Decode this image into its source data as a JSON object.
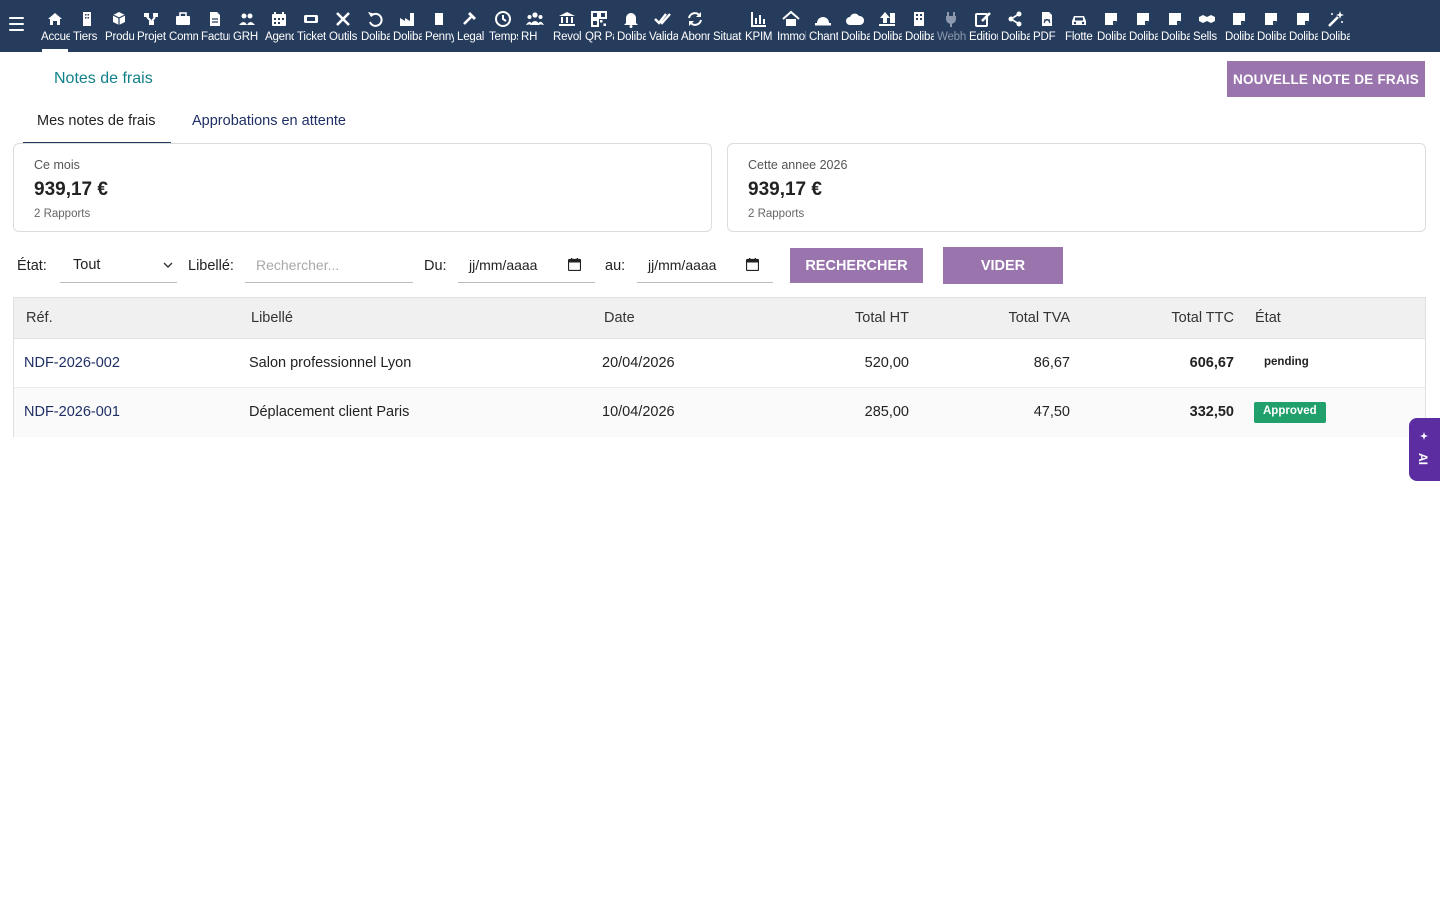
{
  "app": {
    "menu_label": "Menu",
    "nav_items": [
      {
        "label": "Accueil",
        "icon": "home-icon",
        "active": true
      },
      {
        "label": "Tiers",
        "icon": "building-icon"
      },
      {
        "label": "Produits",
        "icon": "cube-icon"
      },
      {
        "label": "Projets",
        "icon": "project-icon"
      },
      {
        "label": "Commercial",
        "icon": "briefcase-icon"
      },
      {
        "label": "Factures",
        "icon": "invoice-icon"
      },
      {
        "label": "GRH",
        "icon": "people-icon"
      },
      {
        "label": "Agenda",
        "icon": "calendar-icon"
      },
      {
        "label": "Tickets",
        "icon": "ticket-icon"
      },
      {
        "label": "Outils",
        "icon": "tools-icon"
      },
      {
        "label": "Dolibarr",
        "icon": "undo-icon"
      },
      {
        "label": "Dolibarr",
        "icon": "industry-icon"
      },
      {
        "label": "Penny",
        "icon": "document-icon"
      },
      {
        "label": "Legal",
        "icon": "gavel-icon"
      },
      {
        "label": "Temps",
        "icon": "clock-icon"
      },
      {
        "label": "RH",
        "icon": "group-icon"
      },
      {
        "label": "Revolut",
        "icon": "bank-icon"
      },
      {
        "label": "QR Pay",
        "icon": "qrcode-icon"
      },
      {
        "label": "Dolibarr",
        "icon": "bell-icon"
      },
      {
        "label": "Validation",
        "icon": "double-check-icon"
      },
      {
        "label": "Abonnements",
        "icon": "refresh-icon"
      },
      {
        "label": "Situation",
        "icon": "blank-icon"
      },
      {
        "label": "KPIM",
        "icon": "bar-chart-icon"
      },
      {
        "label": "Immobilier",
        "icon": "house-icon"
      },
      {
        "label": "Chantier",
        "icon": "hardhat-icon"
      },
      {
        "label": "Dolibarr",
        "icon": "cloud-icon"
      },
      {
        "label": "Dolibarr",
        "icon": "upload-icon"
      },
      {
        "label": "Dolibarr",
        "icon": "office-icon"
      },
      {
        "label": "Webhook",
        "icon": "plug-icon",
        "dim": true
      },
      {
        "label": "Editions",
        "icon": "edit-icon"
      },
      {
        "label": "Dolibarr",
        "icon": "share-icon"
      },
      {
        "label": "PDF",
        "icon": "pdf-icon"
      },
      {
        "label": "Flotte",
        "icon": "car-icon"
      },
      {
        "label": "Dolibarr",
        "icon": "note-icon"
      },
      {
        "label": "Dolibarr",
        "icon": "note-icon"
      },
      {
        "label": "Dolibarr",
        "icon": "note-icon"
      },
      {
        "label": "Sells",
        "icon": "handshake-icon"
      },
      {
        "label": "Dolibarr",
        "icon": "note-icon"
      },
      {
        "label": "Dolibarr",
        "icon": "note-icon"
      },
      {
        "label": "Dolibarr",
        "icon": "note-icon"
      },
      {
        "label": "Dolibarr",
        "icon": "magic-wand-icon"
      }
    ]
  },
  "page": {
    "title": "Notes de frais",
    "new_button": "NOUVELLE NOTE DE FRAIS"
  },
  "tabs": [
    {
      "label": "Mes notes de frais",
      "active": true
    },
    {
      "label": "Approbations en attente",
      "active": false
    }
  ],
  "summary": {
    "month": {
      "caption": "Ce mois",
      "amount": "939,17 €",
      "reports": "2 Rapports"
    },
    "year": {
      "caption": "Cette annee 2026",
      "amount": "939,17 €",
      "reports": "2 Rapports"
    }
  },
  "filters": {
    "state_label": "État:",
    "state_value": "Tout",
    "label_label": "Libellé:",
    "search_placeholder": "Rechercher...",
    "from_label": "Du:",
    "from_value": "jj/mm/aaaa",
    "to_label": "au:",
    "to_value": "jj/mm/aaaa",
    "search_button": "RECHERCHER",
    "clear_button": "VIDER"
  },
  "table": {
    "headers": [
      "Réf.",
      "Libellé",
      "Date",
      "Total HT",
      "Total TVA",
      "Total TTC",
      "État"
    ],
    "rows": [
      {
        "ref": "NDF-2026-002",
        "label": "Salon professionnel Lyon",
        "date": "20/04/2026",
        "ht": "520,00",
        "tva": "86,67",
        "ttc": "606,67",
        "status": "pending"
      },
      {
        "ref": "NDF-2026-001",
        "label": "Déplacement client Paris",
        "date": "10/04/2026",
        "ht": "285,00",
        "tva": "47,50",
        "ttc": "332,50",
        "status": "Approved"
      }
    ]
  },
  "ai_tab": {
    "label": "AI"
  },
  "colors": {
    "topbar": "#263c5c",
    "accent": "#9a74ad",
    "title": "#12808a",
    "link": "#1f2f66",
    "approved": "#22a06b",
    "ai": "#5b2da0"
  }
}
